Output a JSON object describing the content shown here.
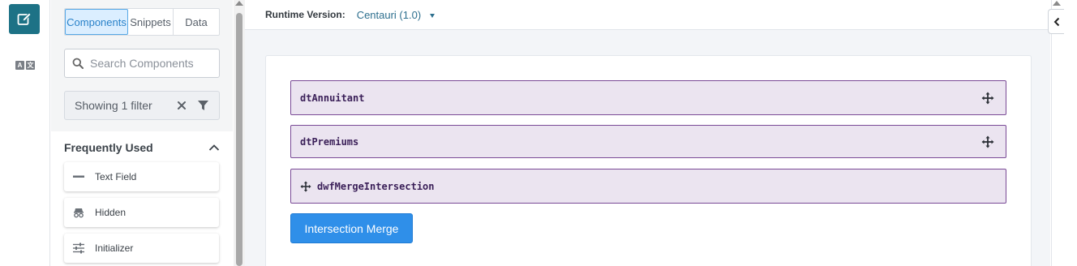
{
  "sidebar_rail": {
    "edit_icon": "edit-icon",
    "translate_icon": "translate-icon",
    "translate_glyphs": [
      "A",
      "文"
    ]
  },
  "panel": {
    "tabs": [
      {
        "label": "Components",
        "active": true
      },
      {
        "label": "Snippets",
        "active": false
      },
      {
        "label": "Data",
        "active": false
      }
    ],
    "search_placeholder": "Search Components",
    "search_value": "",
    "filter_text": "Showing 1 filter",
    "section_title": "Frequently Used",
    "items": [
      {
        "label": "Text Field",
        "icon": "text-field-icon"
      },
      {
        "label": "Hidden",
        "icon": "hidden-icon"
      },
      {
        "label": "Initializer",
        "icon": "sliders-icon"
      }
    ]
  },
  "runtime": {
    "label": "Runtime Version:",
    "value": "Centauri (1.0)"
  },
  "form": {
    "fields": [
      {
        "name": "dtAnnuitant",
        "handle": "right"
      },
      {
        "name": "dtPremiums",
        "handle": "right"
      },
      {
        "name": "dwfMergeIntersection",
        "handle": "left"
      }
    ],
    "button_label": "Intersection Merge"
  },
  "colors": {
    "accent_teal": "#1d7286",
    "field_fill": "#ebe4f0",
    "field_border": "#7a4a96",
    "button_blue": "#2f8fe9",
    "tab_active": "#2a82c9"
  }
}
